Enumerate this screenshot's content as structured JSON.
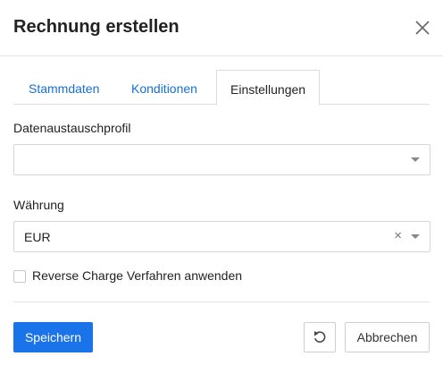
{
  "dialog": {
    "title": "Rechnung erstellen"
  },
  "tabs": [
    {
      "label": "Stammdaten",
      "active": false
    },
    {
      "label": "Konditionen",
      "active": false
    },
    {
      "label": "Einstellungen",
      "active": true
    }
  ],
  "fields": {
    "exchange_profile": {
      "label": "Datenaustauschprofil",
      "value": ""
    },
    "currency": {
      "label": "Währung",
      "value": "EUR"
    },
    "reverse_charge": {
      "label": "Reverse Charge Verfahren anwenden",
      "checked": false
    }
  },
  "actions": {
    "save_label": "Speichern",
    "cancel_label": "Abbrechen"
  },
  "icons": {
    "close": "close-icon",
    "reset": "undo-icon",
    "dropdown": "chevron-down-icon",
    "clear": "clear-icon"
  },
  "colors": {
    "primary": "#1a73e8",
    "tab_link": "#1670d6",
    "border": "#d6d6d6"
  }
}
